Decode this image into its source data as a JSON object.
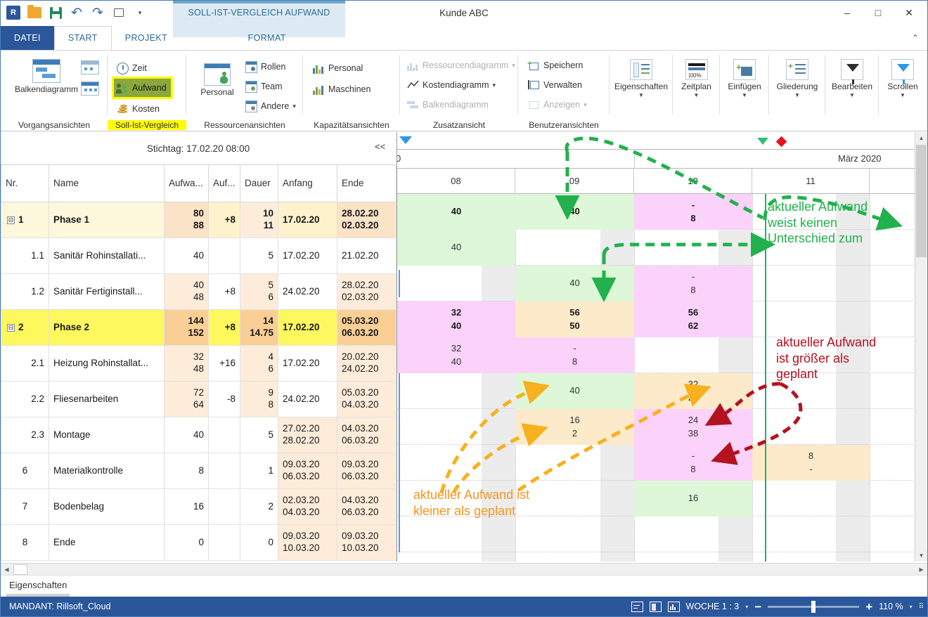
{
  "window": {
    "title": "Kunde ABC",
    "context_tab_title": "SOLL-IST-VERGLEICH AUFWAND",
    "minimize": "–",
    "maximize": "□",
    "close": "✕",
    "collapse_ribbon": "⌃"
  },
  "quick_access": {
    "app_logo": "R",
    "open_label": "open-icon",
    "save_label": "save-icon",
    "undo_label": "↺",
    "redo_label": "↻",
    "new_label": "new-icon",
    "more_label": "▾"
  },
  "tabs": [
    {
      "label": "DATEI",
      "state": "file"
    },
    {
      "label": "START",
      "state": "active"
    },
    {
      "label": "PROJEKT",
      "state": "normal"
    },
    {
      "label": "FORMAT",
      "state": "context"
    }
  ],
  "ribbon": {
    "groups": [
      {
        "name": "Vorgangsansichten",
        "label": "Vorgangsansichten",
        "big_buttons": [
          {
            "label": "Balkendiagramm"
          }
        ],
        "small_buttons": []
      },
      {
        "name": "Soll-Ist-Vergleich",
        "label": "Soll-Ist-Vergleich",
        "label_highlight": true,
        "small_buttons": [
          {
            "label": "Zeit",
            "icon": "clock-icon",
            "highlight": "none"
          },
          {
            "label": "Aufwand",
            "icon": "people-icon",
            "highlight": "green"
          },
          {
            "label": "Kosten",
            "icon": "coins-icon",
            "highlight": "none"
          }
        ]
      },
      {
        "name": "Ressourcenansichten",
        "label": "Ressourcenansichten",
        "big_buttons": [
          {
            "label": "Personal"
          }
        ],
        "small_buttons": [
          {
            "label": "Rollen",
            "icon": "roles-icon"
          },
          {
            "label": "Team",
            "icon": "team-icon"
          },
          {
            "label": "Andere",
            "icon": "other-icon",
            "dropdown": "▾"
          }
        ]
      },
      {
        "name": "Kapazitätsansichten",
        "label": "Kapazitätsansichten",
        "small_buttons": [
          {
            "label": "Personal",
            "icon": "staff-chart-icon"
          },
          {
            "label": "Maschinen",
            "icon": "machines-chart-icon"
          }
        ]
      },
      {
        "name": "Zusatzansicht",
        "label": "Zusatzansicht",
        "small_buttons": [
          {
            "label": "Ressourcendiagramm",
            "icon": "bar-chart-icon",
            "disabled": true,
            "dropdown": "▾"
          },
          {
            "label": "Kostendiagramm",
            "icon": "line-chart-icon",
            "disabled": false,
            "dropdown": "▾"
          },
          {
            "label": "Balkendiagramm",
            "icon": "gantt-icon",
            "disabled": true
          }
        ]
      },
      {
        "name": "Benutzeransichten",
        "label": "Benutzeransichten",
        "small_buttons": [
          {
            "label": "Speichern",
            "icon": "save-view-icon",
            "disabled": false
          },
          {
            "label": "Verwalten",
            "icon": "manage-view-icon",
            "disabled": false
          },
          {
            "label": "Anzeigen",
            "icon": "show-view-icon",
            "disabled": true,
            "dropdown": "▾"
          }
        ]
      }
    ],
    "tool_buttons": [
      {
        "label": "Eigenschaften",
        "icon": "properties-icon",
        "dropdown": "▼"
      },
      {
        "label": "Zeitplan",
        "icon": "schedule-icon",
        "dropdown": "▼"
      },
      {
        "label": "Einfügen",
        "icon": "insert-icon",
        "dropdown": "▼"
      },
      {
        "label": "Gliederung",
        "icon": "outline-icon",
        "dropdown": "▼"
      },
      {
        "label": "Bearbeiten",
        "icon": "filter-icon",
        "dropdown": "▼"
      },
      {
        "label": "Scrollen",
        "icon": "scroll-filter-icon",
        "dropdown": "▼"
      }
    ]
  },
  "stichtag": {
    "text": "Stichtag: 17.02.20 08:00",
    "collapse": "<<"
  },
  "table": {
    "columns": [
      "Nr.",
      "Name",
      "Aufwa...",
      "Auf...",
      "Dauer",
      "Anfang",
      "Ende"
    ],
    "rows": [
      {
        "nr": "1",
        "expander": "⊟",
        "name": "Phase 1",
        "phase": true,
        "level": 0,
        "aufwand_plan": "80",
        "aufwand_ist": "88",
        "diff": "+8",
        "dauer_plan": "10",
        "dauer_ist": "11",
        "anfang_plan": "17.02.20",
        "anfang_ist": "",
        "ende_plan": "28.02.20",
        "ende_ist": "02.03.20"
      },
      {
        "nr": "1.1",
        "name": "Sanitär Rohinstallati...",
        "phase": false,
        "level": 1,
        "aufwand_plan": "40",
        "aufwand_ist": "",
        "diff": "",
        "dauer_plan": "5",
        "dauer_ist": "",
        "anfang_plan": "17.02.20",
        "anfang_ist": "",
        "ende_plan": "21.02.20",
        "ende_ist": ""
      },
      {
        "nr": "1.2",
        "name": "Sanitär Fertiginstall...",
        "phase": false,
        "level": 1,
        "aufwand_plan": "40",
        "aufwand_ist": "48",
        "diff": "+8",
        "dauer_plan": "5",
        "dauer_ist": "6",
        "anfang_plan": "24.02.20",
        "anfang_ist": "",
        "ende_plan": "28.02.20",
        "ende_ist": "02.03.20"
      },
      {
        "nr": "2",
        "expander": "⊟",
        "name": "Phase 2",
        "phase": true,
        "level": 0,
        "selected": true,
        "aufwand_plan": "144",
        "aufwand_ist": "152",
        "diff": "+8",
        "dauer_plan": "14",
        "dauer_ist": "14.75",
        "anfang_plan": "17.02.20",
        "anfang_ist": "",
        "ende_plan": "05.03.20",
        "ende_ist": "06.03.20"
      },
      {
        "nr": "2.1",
        "name": "Heizung Rohinstallat...",
        "phase": false,
        "level": 1,
        "aufwand_plan": "32",
        "aufwand_ist": "48",
        "diff": "+16",
        "dauer_plan": "4",
        "dauer_ist": "6",
        "anfang_plan": "17.02.20",
        "anfang_ist": "",
        "ende_plan": "20.02.20",
        "ende_ist": "24.02.20"
      },
      {
        "nr": "2.2",
        "name": "Fliesenarbeiten",
        "phase": false,
        "level": 1,
        "aufwand_plan": "72",
        "aufwand_ist": "64",
        "diff": "-8",
        "dauer_plan": "9",
        "dauer_ist": "8",
        "anfang_plan": "24.02.20",
        "anfang_ist": "",
        "ende_plan": "05.03.20",
        "ende_ist": "04.03.20"
      },
      {
        "nr": "2.3",
        "name": "Montage",
        "phase": false,
        "level": 1,
        "aufwand_plan": "40",
        "aufwand_ist": "",
        "diff": "",
        "dauer_plan": "5",
        "dauer_ist": "",
        "anfang_plan": "27.02.20",
        "anfang_ist": "28.02.20",
        "ende_plan": "04.03.20",
        "ende_ist": "06.03.20"
      },
      {
        "nr": "6",
        "name": "Materialkontrolle",
        "phase": false,
        "level": 0,
        "aufwand_plan": "8",
        "aufwand_ist": "",
        "diff": "",
        "dauer_plan": "1",
        "dauer_ist": "",
        "anfang_plan": "09.03.20",
        "anfang_ist": "06.03.20",
        "ende_plan": "09.03.20",
        "ende_ist": "06.03.20"
      },
      {
        "nr": "7",
        "name": "Bodenbelag",
        "phase": false,
        "level": 0,
        "aufwand_plan": "16",
        "aufwand_ist": "",
        "diff": "",
        "dauer_plan": "2",
        "dauer_ist": "",
        "anfang_plan": "02.03.20",
        "anfang_ist": "04.03.20",
        "ende_plan": "04.03.20",
        "ende_ist": "06.03.20"
      },
      {
        "nr": "8",
        "name": "Ende",
        "phase": false,
        "level": 0,
        "aufwand_plan": "0",
        "aufwand_ist": "",
        "diff": "",
        "dauer_plan": "0",
        "dauer_ist": "",
        "anfang_plan": "09.03.20",
        "anfang_ist": "10.03.20",
        "ende_plan": "09.03.20",
        "ende_ist": "10.03.20"
      }
    ]
  },
  "gantt": {
    "month_label_right": "März 2020",
    "month_label_left_clipped": "0",
    "weeks": [
      "08",
      "09",
      "10",
      "11"
    ],
    "cells": [
      {
        "row": 0,
        "week": 0,
        "plan": "40",
        "ist": "",
        "color": "green",
        "bold": true
      },
      {
        "row": 0,
        "week": 1,
        "plan": "40",
        "ist": "",
        "color": "green",
        "bold": true
      },
      {
        "row": 0,
        "week": 2,
        "plan": "-",
        "ist": "8",
        "color": "pink",
        "bold": true
      },
      {
        "row": 1,
        "week": 0,
        "plan": "40",
        "ist": "",
        "color": "green",
        "bold": false
      },
      {
        "row": 2,
        "week": 1,
        "plan": "40",
        "ist": "",
        "color": "green",
        "bold": false
      },
      {
        "row": 2,
        "week": 2,
        "plan": "-",
        "ist": "8",
        "color": "pink",
        "bold": false
      },
      {
        "row": 3,
        "week": 0,
        "plan": "32",
        "ist": "40",
        "color": "pink",
        "bold": true
      },
      {
        "row": 3,
        "week": 1,
        "plan": "56",
        "ist": "50",
        "color": "orange",
        "bold": true
      },
      {
        "row": 3,
        "week": 2,
        "plan": "56",
        "ist": "62",
        "color": "pink",
        "bold": true
      },
      {
        "row": 4,
        "week": 0,
        "plan": "32",
        "ist": "40",
        "color": "pink",
        "bold": false
      },
      {
        "row": 4,
        "week": 1,
        "plan": "-",
        "ist": "8",
        "color": "pink",
        "bold": false
      },
      {
        "row": 5,
        "week": 1,
        "plan": "40",
        "ist": "",
        "color": "green",
        "bold": false
      },
      {
        "row": 5,
        "week": 2,
        "plan": "32",
        "ist": "24",
        "color": "orange",
        "bold": false
      },
      {
        "row": 6,
        "week": 1,
        "plan": "16",
        "ist": "2",
        "color": "orange",
        "bold": false
      },
      {
        "row": 6,
        "week": 2,
        "plan": "24",
        "ist": "38",
        "color": "pink",
        "bold": false
      },
      {
        "row": 7,
        "week": 2,
        "plan": "-",
        "ist": "8",
        "color": "pink",
        "bold": false
      },
      {
        "row": 7,
        "week": 3,
        "plan": "8",
        "ist": "-",
        "color": "orange",
        "bold": false
      },
      {
        "row": 8,
        "week": 2,
        "plan": "16",
        "ist": "",
        "color": "green",
        "bold": false
      }
    ],
    "annotations": [
      {
        "name": "annotation-no-difference",
        "color": "green",
        "text": "aktueller Aufwand\nweist keinen\nUnterschied zum"
      },
      {
        "name": "annotation-greater-than-planned",
        "color": "red",
        "text": "aktueller Aufwand\nist größer als\ngeplant"
      },
      {
        "name": "annotation-less-than-planned",
        "color": "orange",
        "text": "aktueller Aufwand ist\nkleiner als geplant"
      }
    ],
    "colors": {
      "green_cell": "#ddf7d8",
      "pink_cell": "#fbd2fa",
      "orange_cell": "#fdeacb",
      "today_line": "#1eb36b",
      "annotation_green": "#22b14c",
      "annotation_red": "#b4121f",
      "annotation_orange": "#f7941e"
    }
  },
  "bottom_tab": {
    "label": "Eigenschaften"
  },
  "statusbar": {
    "client": "MANDANT: Rillsoft_Cloud",
    "scale_label": "WOCHE 1 : 3",
    "scale_caret": "▾",
    "zoom_minus": "−",
    "zoom_plus": "+",
    "zoom_value": "110 %",
    "zoom_caret": "▾",
    "icons": [
      "view-split-icon",
      "table-view-icon",
      "chart-view-icon",
      "resize-grip-icon"
    ]
  }
}
